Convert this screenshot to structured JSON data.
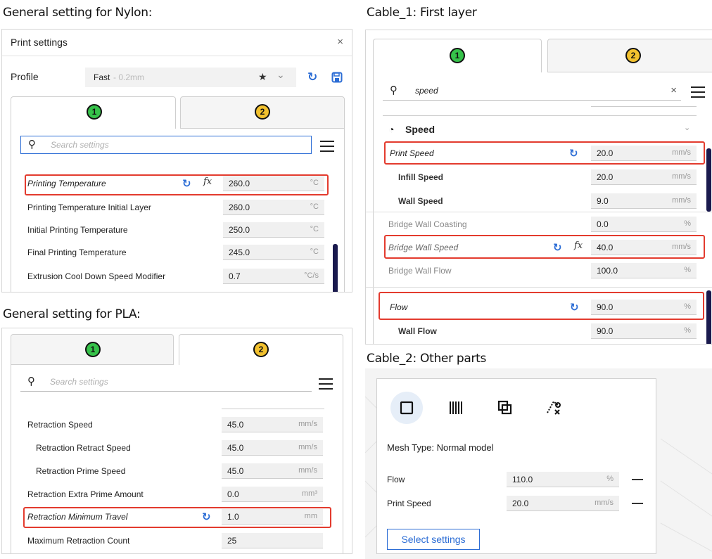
{
  "captions": {
    "nylon": "General setting for Nylon:",
    "pla": "General setting for PLA:",
    "cable1": "Cable_1: First layer",
    "cable2": "Cable_2: Other parts"
  },
  "nylon_panel": {
    "title": "Print settings",
    "close": "×",
    "profile_label": "Profile",
    "profile_value": "Fast",
    "profile_sub": " - 0.2mm",
    "tabs": [
      "1",
      "2"
    ],
    "search_placeholder": "Search settings",
    "rows": [
      {
        "label": "Printing Temperature",
        "value": "260.0",
        "unit": "°C"
      },
      {
        "label": "Printing Temperature Initial Layer",
        "value": "260.0",
        "unit": "°C"
      },
      {
        "label": "Initial Printing Temperature",
        "value": "250.0",
        "unit": "°C"
      },
      {
        "label": "Final Printing Temperature",
        "value": "245.0",
        "unit": "°C"
      },
      {
        "label": "Extrusion Cool Down Speed Modifier",
        "value": "0.7",
        "unit": "°C/s"
      }
    ]
  },
  "pla_panel": {
    "tabs": [
      "1",
      "2"
    ],
    "search_placeholder": "Search settings",
    "rows": [
      {
        "label": "Retraction Speed",
        "value": "45.0",
        "unit": "mm/s"
      },
      {
        "label": "Retraction Retract Speed",
        "value": "45.0",
        "unit": "mm/s"
      },
      {
        "label": "Retraction Prime Speed",
        "value": "45.0",
        "unit": "mm/s"
      },
      {
        "label": "Retraction Extra Prime Amount",
        "value": "0.0",
        "unit": "mm³"
      },
      {
        "label": "Retraction Minimum Travel",
        "value": "1.0",
        "unit": "mm"
      },
      {
        "label": "Maximum Retraction Count",
        "value": "25",
        "unit": ""
      }
    ]
  },
  "cable1_panel": {
    "tabs": [
      "1",
      "2"
    ],
    "search_value": "speed",
    "clear": "×",
    "category": "Speed",
    "rows": [
      {
        "label": "Print Speed",
        "value": "20.0",
        "unit": "mm/s"
      },
      {
        "label": "Infill Speed",
        "value": "20.0",
        "unit": "mm/s"
      },
      {
        "label": "Wall Speed",
        "value": "9.0",
        "unit": "mm/s"
      },
      {
        "label": "Bridge Wall Coasting",
        "value": "0.0",
        "unit": "%"
      },
      {
        "label": "Bridge Wall Speed",
        "value": "40.0",
        "unit": "mm/s"
      },
      {
        "label": "Bridge Wall Flow",
        "value": "100.0",
        "unit": "%"
      },
      {
        "label": "Flow",
        "value": "90.0",
        "unit": "%"
      },
      {
        "label": "Wall Flow",
        "value": "90.0",
        "unit": "%"
      }
    ]
  },
  "cable2_panel": {
    "mesh_type": "Mesh Type: Normal model",
    "rows": [
      {
        "label": "Flow",
        "value": "110.0",
        "unit": "%"
      },
      {
        "label": "Print Speed",
        "value": "20.0",
        "unit": "mm/s"
      }
    ],
    "select_button": "Select settings"
  },
  "icons": {
    "search": "⚲",
    "reset": "↻",
    "fx": "fx",
    "star": "★",
    "chevron": "⌄"
  },
  "colors": {
    "accent": "#2c6dd5",
    "highlight": "#e33b2e",
    "badge1": "#36c24a",
    "badge2": "#f2c12e"
  }
}
